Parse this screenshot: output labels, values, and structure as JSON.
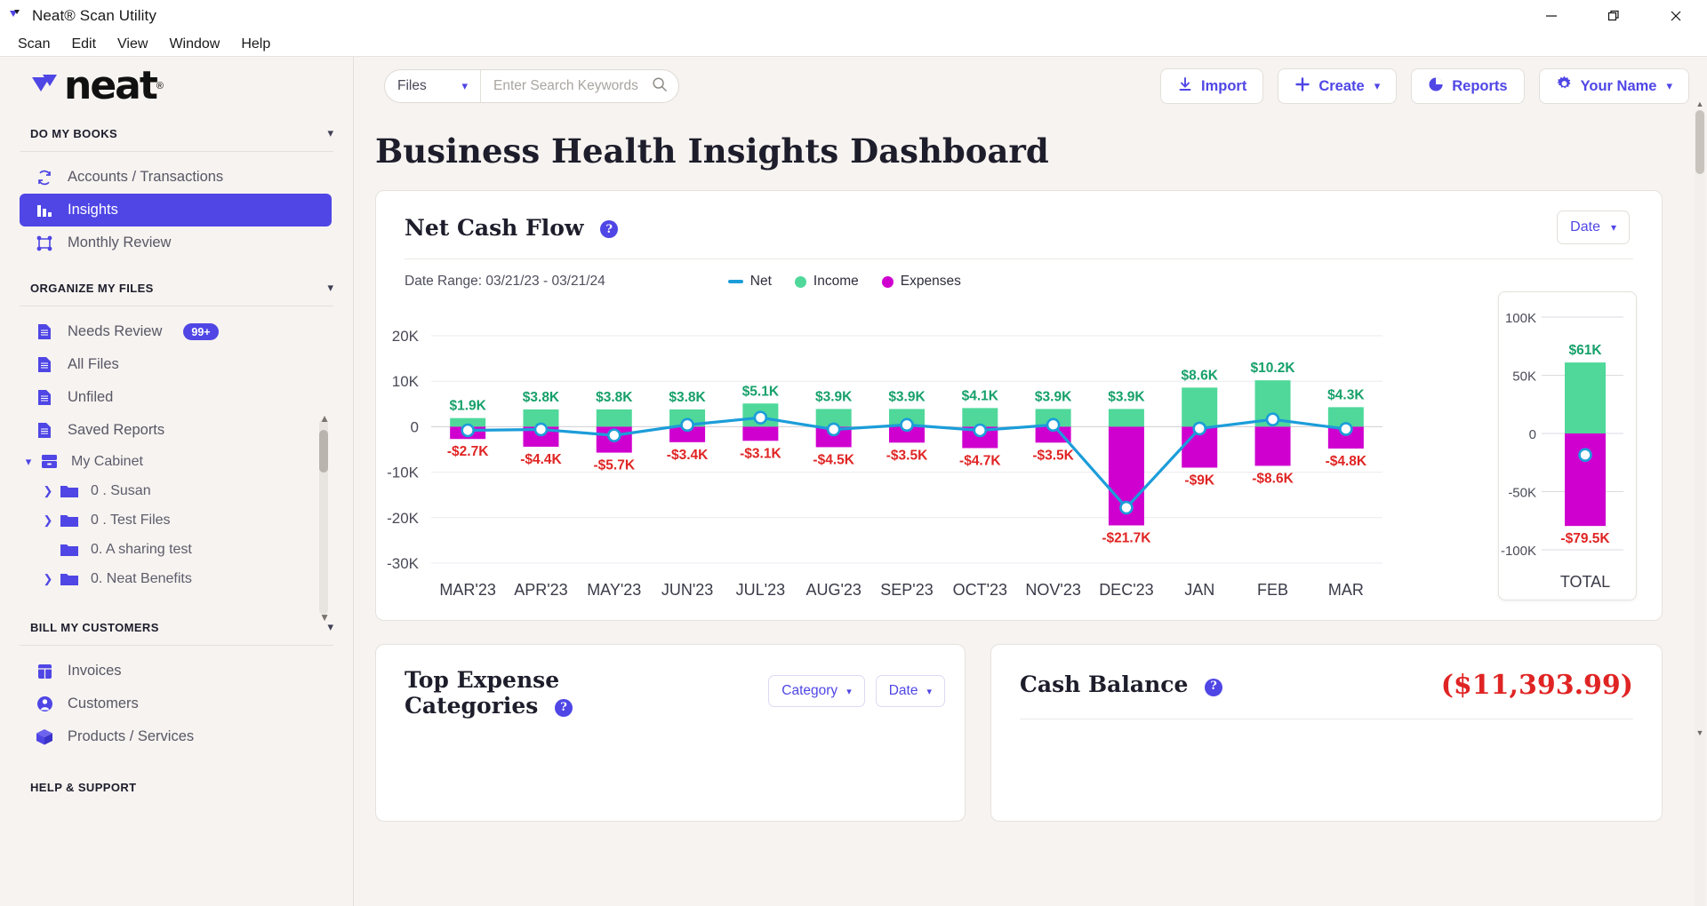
{
  "window": {
    "title": "Neat® Scan Utility",
    "controls": {
      "minimize": "minimize-icon",
      "maximize": "maximize-icon",
      "close": "close-icon"
    }
  },
  "menubar": {
    "items": [
      "Scan",
      "Edit",
      "View",
      "Window",
      "Help"
    ]
  },
  "sidebar": {
    "brand": {
      "text": "neat",
      "reg": "®"
    },
    "sections": [
      {
        "title": "DO MY BOOKS",
        "items": [
          {
            "label": "Accounts / Transactions",
            "icon": "sync-icon",
            "active": false
          },
          {
            "label": "Insights",
            "icon": "bar-chart-icon",
            "active": true
          },
          {
            "label": "Monthly Review",
            "icon": "grid-nodes-icon",
            "active": false
          }
        ]
      },
      {
        "title": "ORGANIZE MY FILES",
        "items": [
          {
            "label": "Needs Review",
            "icon": "document-icon",
            "badge": "99+"
          },
          {
            "label": "All Files",
            "icon": "document-icon"
          },
          {
            "label": "Unfiled",
            "icon": "document-icon"
          },
          {
            "label": "Saved Reports",
            "icon": "document-icon"
          },
          {
            "label": "My Cabinet",
            "icon": "cabinet-icon",
            "expanded": true
          }
        ],
        "tree": [
          {
            "label": "0 . Susan",
            "arrow": true
          },
          {
            "label": "0 . Test Files",
            "arrow": true
          },
          {
            "label": "0. A sharing test",
            "arrow": false
          },
          {
            "label": "0. Neat Benefits",
            "arrow": true
          }
        ]
      },
      {
        "title": "BILL MY CUSTOMERS",
        "items": [
          {
            "label": "Invoices",
            "icon": "invoice-icon"
          },
          {
            "label": "Customers",
            "icon": "person-icon"
          },
          {
            "label": "Products / Services",
            "icon": "box-icon"
          }
        ]
      },
      {
        "title": "HELP & SUPPORT",
        "items": []
      }
    ]
  },
  "toolbar": {
    "search_scope": "Files",
    "search_placeholder": "Enter Search Keywords",
    "search_value": "",
    "import_label": "Import",
    "create_label": "Create",
    "reports_label": "Reports",
    "account_label": "Your Name"
  },
  "page": {
    "title": "Business Health Insights Dashboard"
  },
  "net_cash_flow": {
    "title": "Net Cash Flow",
    "help": "?",
    "date_selector": "Date",
    "date_range_label": "Date Range: 03/21/23 - 03/21/24",
    "legend": [
      {
        "label": "Net",
        "color": "#1b9dd9",
        "type": "line"
      },
      {
        "label": "Income",
        "color": "#4fd89a",
        "type": "dot"
      },
      {
        "label": "Expenses",
        "color": "#cf00cf",
        "type": "dot"
      }
    ],
    "total_label": "TOTAL"
  },
  "top_expense": {
    "title_line1": "Top Expense",
    "title_line2": "Categories",
    "help": "?",
    "category_selector": "Category",
    "date_selector": "Date"
  },
  "cash_balance": {
    "title": "Cash Balance",
    "help": "?",
    "value": "($11,393.99)"
  },
  "colors": {
    "accent": "#4f46e5",
    "income": "#4fd89a",
    "expense": "#cf00cf",
    "net_line": "#1b9dd9",
    "income_label": "#16a06a",
    "expense_label": "#e02424",
    "sidebar_bg": "#f7f3f0"
  },
  "chart_data": {
    "type": "bar",
    "title": "Net Cash Flow",
    "xlabel": "",
    "ylabel": "",
    "ylim": [
      -30000,
      20000
    ],
    "yticks": [
      20000,
      10000,
      0,
      -10000,
      -20000,
      -30000
    ],
    "ytick_labels": [
      "20K",
      "10K",
      "0",
      "-10K",
      "-20K",
      "-30K"
    ],
    "grid": true,
    "legend_position": "top-center",
    "categories": [
      "MAR'23",
      "APR'23",
      "MAY'23",
      "JUN'23",
      "JUL'23",
      "AUG'23",
      "SEP'23",
      "OCT'23",
      "NOV'23",
      "DEC'23",
      "JAN",
      "FEB",
      "MAR"
    ],
    "series": [
      {
        "name": "Income",
        "color": "#4fd89a",
        "values": [
          1900,
          3800,
          3800,
          3800,
          5100,
          3900,
          3900,
          4100,
          3900,
          3900,
          8600,
          10200,
          4300
        ],
        "labels": [
          "$1.9K",
          "$3.8K",
          "$3.8K",
          "$3.8K",
          "$5.1K",
          "$3.9K",
          "$3.9K",
          "$4.1K",
          "$3.9K",
          "$3.9K",
          "$8.6K",
          "$10.2K",
          "$4.3K"
        ]
      },
      {
        "name": "Expenses",
        "color": "#cf00cf",
        "values": [
          -2700,
          -4400,
          -5700,
          -3400,
          -3100,
          -4500,
          -3500,
          -4700,
          -3500,
          -21700,
          -9000,
          -8600,
          -4800
        ],
        "labels": [
          "-$2.7K",
          "-$4.4K",
          "-$5.7K",
          "-$3.4K",
          "-$3.1K",
          "-$4.5K",
          "-$3.5K",
          "-$4.7K",
          "-$3.5K",
          "-$21.7K",
          "-$9K",
          "-$8.6K",
          "-$4.8K"
        ]
      },
      {
        "name": "Net",
        "color": "#1b9dd9",
        "type": "line",
        "values": [
          -800,
          -600,
          -1900,
          400,
          2000,
          -600,
          400,
          -800,
          400,
          -17800,
          -400,
          1600,
          -500
        ]
      }
    ],
    "total_panel": {
      "label": "TOTAL",
      "yticks": [
        100000,
        50000,
        0,
        -50000,
        -100000
      ],
      "ytick_labels": [
        "100K",
        "50K",
        "0",
        "-50K",
        "-100K"
      ],
      "income": 61000,
      "income_label": "$61K",
      "expense": -79500,
      "expense_label": "-$79.5K",
      "net": -18500
    }
  }
}
